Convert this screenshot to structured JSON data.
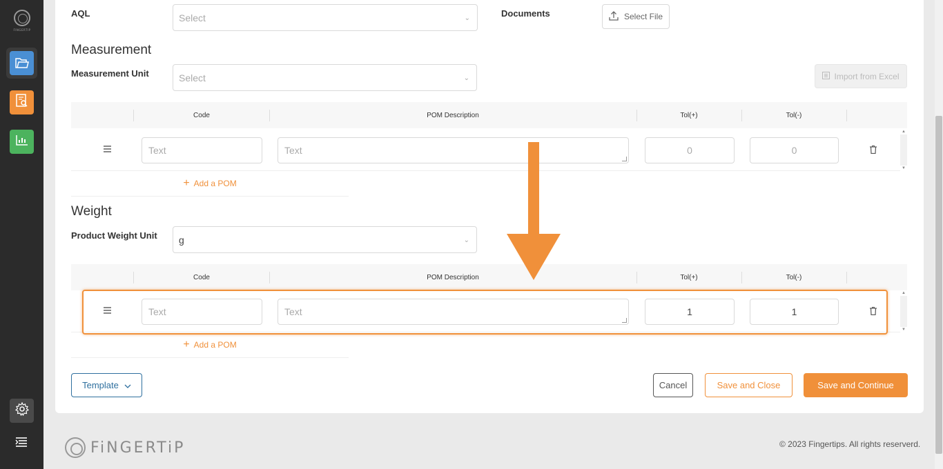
{
  "sidebar": {
    "logo_text": "FINGERTIP",
    "items": [
      {
        "icon": "folder-icon",
        "color": "#4a8fd4"
      },
      {
        "icon": "report-search-icon",
        "color": "#f0903a"
      },
      {
        "icon": "bar-chart-icon",
        "color": "#4cb35e"
      }
    ],
    "settings_icon": "gear-icon",
    "menu_icon": "menu-icon"
  },
  "form": {
    "aql": {
      "label": "AQL",
      "placeholder": "Select"
    },
    "documents": {
      "label": "Documents",
      "button": "Select File"
    },
    "measurement": {
      "heading": "Measurement",
      "unit_label": "Measurement Unit",
      "unit_placeholder": "Select",
      "import_button": "Import from Excel",
      "columns": [
        "Code",
        "POM Description",
        "Tol(+)",
        "Tol(-)"
      ],
      "row": {
        "code_placeholder": "Text",
        "description_placeholder": "Text",
        "tol_plus": "0",
        "tol_minus": "0"
      },
      "add_pom": "Add a POM"
    },
    "weight": {
      "heading": "Weight",
      "unit_label": "Product Weight Unit",
      "unit_value": "g",
      "columns": [
        "Code",
        "POM Description",
        "Tol(+)",
        "Tol(-)"
      ],
      "row": {
        "code_placeholder": "Text",
        "description_placeholder": "Text",
        "tol_plus": "1",
        "tol_minus": "1"
      },
      "add_pom": "Add a POM"
    }
  },
  "actions": {
    "template": "Template",
    "cancel": "Cancel",
    "save_close": "Save and Close",
    "save_continue": "Save and Continue"
  },
  "footer": {
    "brand": "FiNGERTiP",
    "copyright": "© 2023 Fingertips. All rights reserverd."
  },
  "colors": {
    "accent": "#f0903a",
    "primary": "#2e6f9e",
    "sidebar_bg": "#2b2b2b"
  }
}
